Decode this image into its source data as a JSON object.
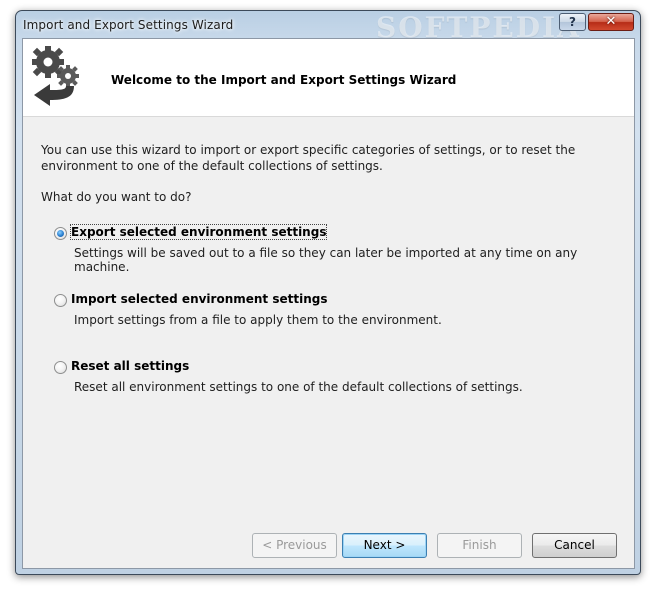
{
  "window": {
    "title": "Import and Export Settings Wizard",
    "watermark": "SOFTPEDIA",
    "help_glyph": "?",
    "close_glyph": "✕"
  },
  "header": {
    "title": "Welcome to the Import and Export Settings Wizard",
    "icon": "gears-arrow-icon"
  },
  "content": {
    "intro": "You can use this wizard to import or export specific categories of settings, or to reset the environment to one of the default collections of settings.",
    "question": "What do you want to do?",
    "options": [
      {
        "label": "Export selected environment settings",
        "description": "Settings will be saved out to a file so they can later be imported at any time on any machine.",
        "selected": true
      },
      {
        "label": "Import selected environment settings",
        "description": "Import settings from a file to apply them to the environment.",
        "selected": false
      },
      {
        "label": "Reset all settings",
        "description": "Reset all environment settings to one of the default collections of settings.",
        "selected": false
      }
    ]
  },
  "buttons": {
    "previous": "< Previous",
    "next": "Next >",
    "finish": "Finish",
    "cancel": "Cancel",
    "previous_enabled": false,
    "finish_enabled": false
  },
  "colors": {
    "title_bar": "#c8d9ea",
    "client_bg": "#f0f0f0",
    "close_red": "#c4402a",
    "default_button_border": "#3c7fb1"
  }
}
